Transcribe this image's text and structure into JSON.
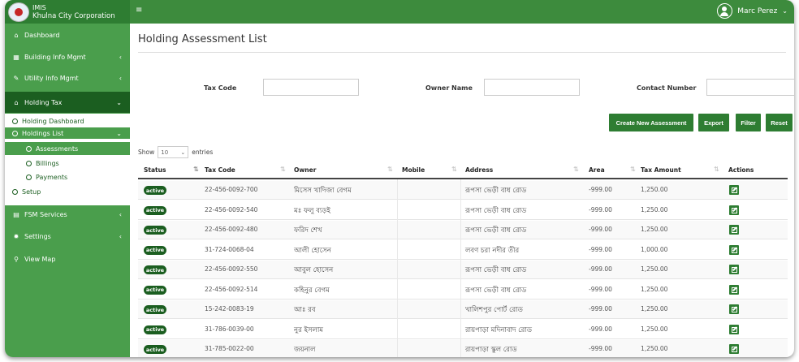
{
  "app": {
    "short_name": "IMIS",
    "org_name": "Khulna City Corporation",
    "menu_icon": "≡",
    "user_name": "Marc Perez",
    "user_caret": "⌄"
  },
  "colors": {
    "brand_green": "#2e7d32",
    "sidebar_green": "#4a9e4c",
    "topbar_green": "#3d8b3d",
    "active_dark": "#1b5e20"
  },
  "sidebar": {
    "dashboard": "Dashboard",
    "building_info": "Building Info Mgmt",
    "utility_info": "Utility Info Mgmt",
    "holding_tax": "Holding Tax",
    "holding_dashboard": "Holding Dashboard",
    "holdings_list": "Holdings List",
    "assessments": "Assessments",
    "billings": "Billings",
    "payments": "Payments",
    "setup": "Setup",
    "fsm_services": "FSM Services",
    "settings": "Settings",
    "view_map": "View Map",
    "chevron_left": "‹",
    "chevron_down": "⌄"
  },
  "page": {
    "title": "Holding Assessment List"
  },
  "filters": {
    "tax_code_label": "Tax Code",
    "owner_name_label": "Owner Name",
    "contact_number_label": "Contact Number"
  },
  "buttons": {
    "create": "Create New Assessment",
    "export": "Export",
    "filter": "Filter",
    "reset": "Reset"
  },
  "entries": {
    "show": "Show",
    "value": "10",
    "suffix": "entries",
    "caret": "⌄"
  },
  "table": {
    "headers": {
      "status": "Status",
      "tax_code": "Tax Code",
      "owner": "Owner",
      "mobile": "Mobile",
      "address": "Address",
      "area": "Area",
      "tax_amount": "Tax Amount",
      "actions": "Actions"
    },
    "sort_icon": "⇅",
    "rows": [
      {
        "status": "active",
        "tax_code": "22-456-0092-700",
        "owner": "মিসেস খাদিজা বেগম",
        "mobile": "",
        "address": "রূপসা ভেড়ী বাধ রোড",
        "area": "-999.00",
        "tax_amount": "1,250.00"
      },
      {
        "status": "active",
        "tax_code": "22-456-0092-540",
        "owner": "মঃ ফলু ব্যড়ই",
        "mobile": "",
        "address": "রূপসা ভেড়ী বাধ রোড",
        "area": "-999.00",
        "tax_amount": "1,250.00"
      },
      {
        "status": "active",
        "tax_code": "22-456-0092-480",
        "owner": "ফরিদ শেখ",
        "mobile": "",
        "address": "রূপসা ভেড়ী বাধ রোড",
        "area": "-999.00",
        "tax_amount": "1,250.00"
      },
      {
        "status": "active",
        "tax_code": "31-724-0068-04",
        "owner": "আলী হোসেন",
        "mobile": "",
        "address": "লবণ চরা নদীর তীর",
        "area": "-999.00",
        "tax_amount": "1,000.00"
      },
      {
        "status": "active",
        "tax_code": "22-456-0092-550",
        "owner": "আবুল হোসেন",
        "mobile": "",
        "address": "রূপসা ভেড়ী বাধ রোড",
        "area": "-999.00",
        "tax_amount": "1,250.00"
      },
      {
        "status": "active",
        "tax_code": "22-456-0092-514",
        "owner": "কহিনুর বেগম",
        "mobile": "",
        "address": "রূপসা ভেড়ী বাধ রোড",
        "area": "-999.00",
        "tax_amount": "1,250.00"
      },
      {
        "status": "active",
        "tax_code": "15-242-0083-19",
        "owner": "আঃ রব",
        "mobile": "",
        "address": "খালিশপুর পোর্ট রোড",
        "area": "-999.00",
        "tax_amount": "1,250.00"
      },
      {
        "status": "active",
        "tax_code": "31-786-0039-00",
        "owner": "নুর ইসলাম",
        "mobile": "",
        "address": "রায়পাড়া মদিনাবাদ রোড",
        "area": "-999.00",
        "tax_amount": "1,250.00"
      },
      {
        "status": "active",
        "tax_code": "31-785-0022-00",
        "owner": "জয়নাল",
        "mobile": "",
        "address": "রায়পাড়া স্কুল রোড",
        "area": "-999.00",
        "tax_amount": "1,250.00"
      }
    ]
  }
}
